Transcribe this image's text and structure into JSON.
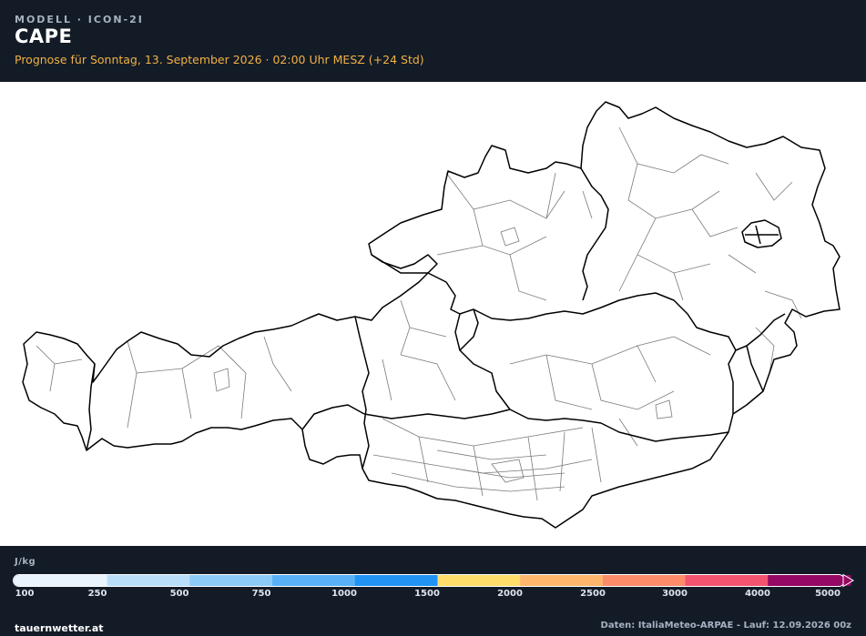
{
  "header": {
    "model": "MODELL · ICON-2I",
    "title": "CAPE",
    "subtitle": "Prognose für Sonntag, 13. September 2026 · 02:00 Uhr MESZ  (+24 Std)"
  },
  "legend": {
    "unit": "J/kg",
    "ticks": [
      "100",
      "250",
      "500",
      "750",
      "1000",
      "1500",
      "2000",
      "2500",
      "3000",
      "4000",
      "5000"
    ],
    "colors": [
      "#e9f4fd",
      "#b9defa",
      "#8ccbf7",
      "#58b1f6",
      "#2193f3",
      "#ffdd6a",
      "#fdb66c",
      "#fc8b6a",
      "#f45470",
      "#950863"
    ]
  },
  "footer": {
    "brand": "tauernwetter.at",
    "credit": "Daten: ItaliaMeteo-ARPAE - Lauf: 12.09.2026 00z"
  },
  "map": {
    "region": "Austria",
    "land_color": "#ffffff",
    "state_border_color": "#000000",
    "district_border_color": "#7a7a7a"
  }
}
